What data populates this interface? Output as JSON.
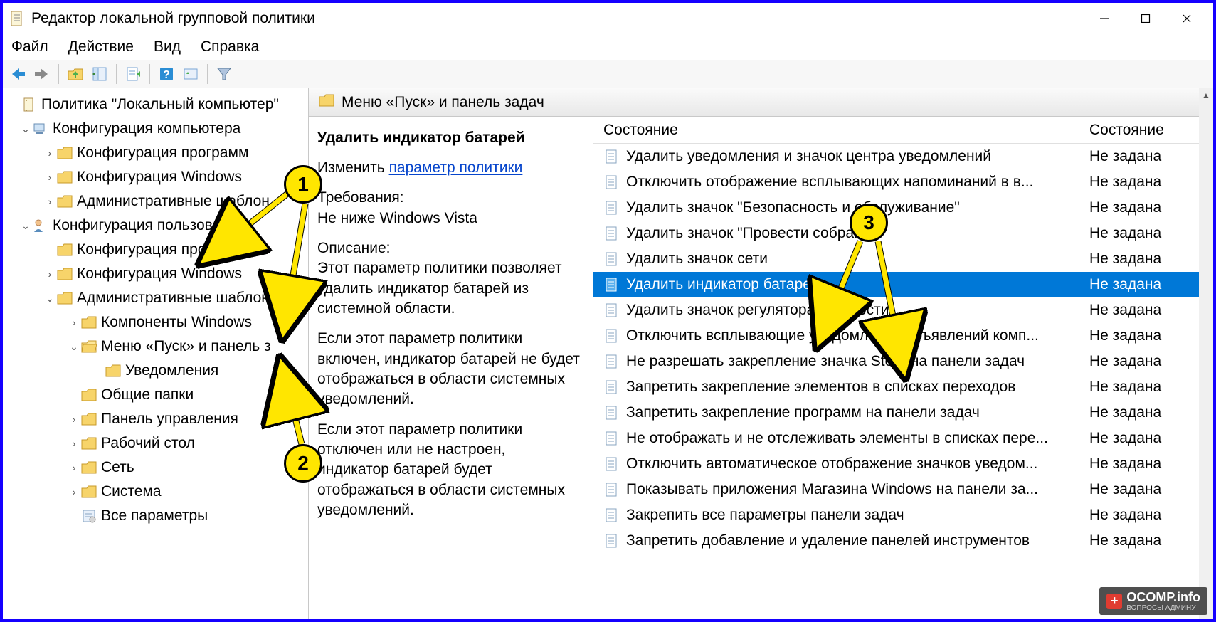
{
  "title": "Редактор локальной групповой политики",
  "menu": {
    "file": "Файл",
    "action": "Действие",
    "view": "Вид",
    "help": "Справка"
  },
  "tree": {
    "root": "Политика \"Локальный компьютер\"",
    "comp": "Конфигурация компьютера",
    "comp_software": "Конфигурация программ",
    "comp_windows": "Конфигурация Windows",
    "comp_admin": "Административные шаблон",
    "user": "Конфигурация пользователя",
    "user_software": "Конфигурация программ",
    "user_windows": "Конфигурация Windows",
    "user_admin": "Административные шаблоны",
    "comp_win": "Компоненты Windows",
    "startmenu": "Меню «Пуск» и панель з",
    "notif": "Уведомления",
    "shared": "Общие папки",
    "control": "Панель управления",
    "desktop": "Рабочий стол",
    "network": "Сеть",
    "system": "Система",
    "all": "Все параметры"
  },
  "header_label": "Меню «Пуск» и панель задач",
  "detail": {
    "heading": "Удалить индикатор батарей",
    "edit_prefix": "Изменить ",
    "edit_link": "параметр политики",
    "req_label": "Требования:",
    "req_value": "Не ниже Windows Vista",
    "desc_label": "Описание:",
    "desc1": "Этот параметр политики позволяет удалить индикатор батарей из системной области.",
    "desc2": "Если этот параметр политики включен, индикатор батарей не будет отображаться в области системных уведомлений.",
    "desc3": "Если этот параметр политики отключен или не настроен, индикатор батарей будет отображаться в области системных уведомлений."
  },
  "list": {
    "col1": "Состояние",
    "col2": "Состояние",
    "state_default": "Не задана",
    "items": [
      "Удалить уведомления и значок центра уведомлений",
      "Отключить отображение всплывающих напоминаний в в...",
      "Удалить значок \"Безопасность и обслуживание\"",
      "Удалить значок \"Провести собрание\"",
      "Удалить значок сети",
      "Удалить индикатор батарей",
      "Удалить значок регулятора громкости",
      "Отключить всплывающие уведомления объявлений комп...",
      "Не разрешать закрепление значка Store на панели задач",
      "Запретить закрепление элементов в списках переходов",
      "Запретить закрепление программ на панели задач",
      "Не отображать и не отслеживать элементы в списках пере...",
      "Отключить автоматическое отображение значков уведом...",
      "Показывать приложения Магазина Windows на панели за...",
      "Закрепить все параметры панели задач",
      "Запретить добавление и удаление панелей инструментов"
    ],
    "selected_index": 5
  },
  "watermark": {
    "brand": "OCOMP",
    "tld": ".info",
    "sub": "ВОПРОСЫ АДМИНУ"
  }
}
